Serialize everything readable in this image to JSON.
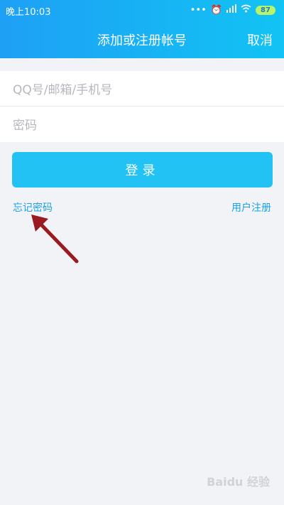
{
  "statusbar": {
    "time": "晚上10:03",
    "battery": "87"
  },
  "header": {
    "title": "添加或注册帐号",
    "cancel": "取消"
  },
  "form": {
    "account_placeholder": "QQ号/邮箱/手机号",
    "password_placeholder": "密码"
  },
  "login_button": "登录",
  "links": {
    "forgot": "忘记密码",
    "register": "用户注册"
  },
  "watermark": "Baidu 经验",
  "colors": {
    "accent": "#22c3f4",
    "link": "#1ba0e9",
    "arrow": "#9b1a1f"
  }
}
